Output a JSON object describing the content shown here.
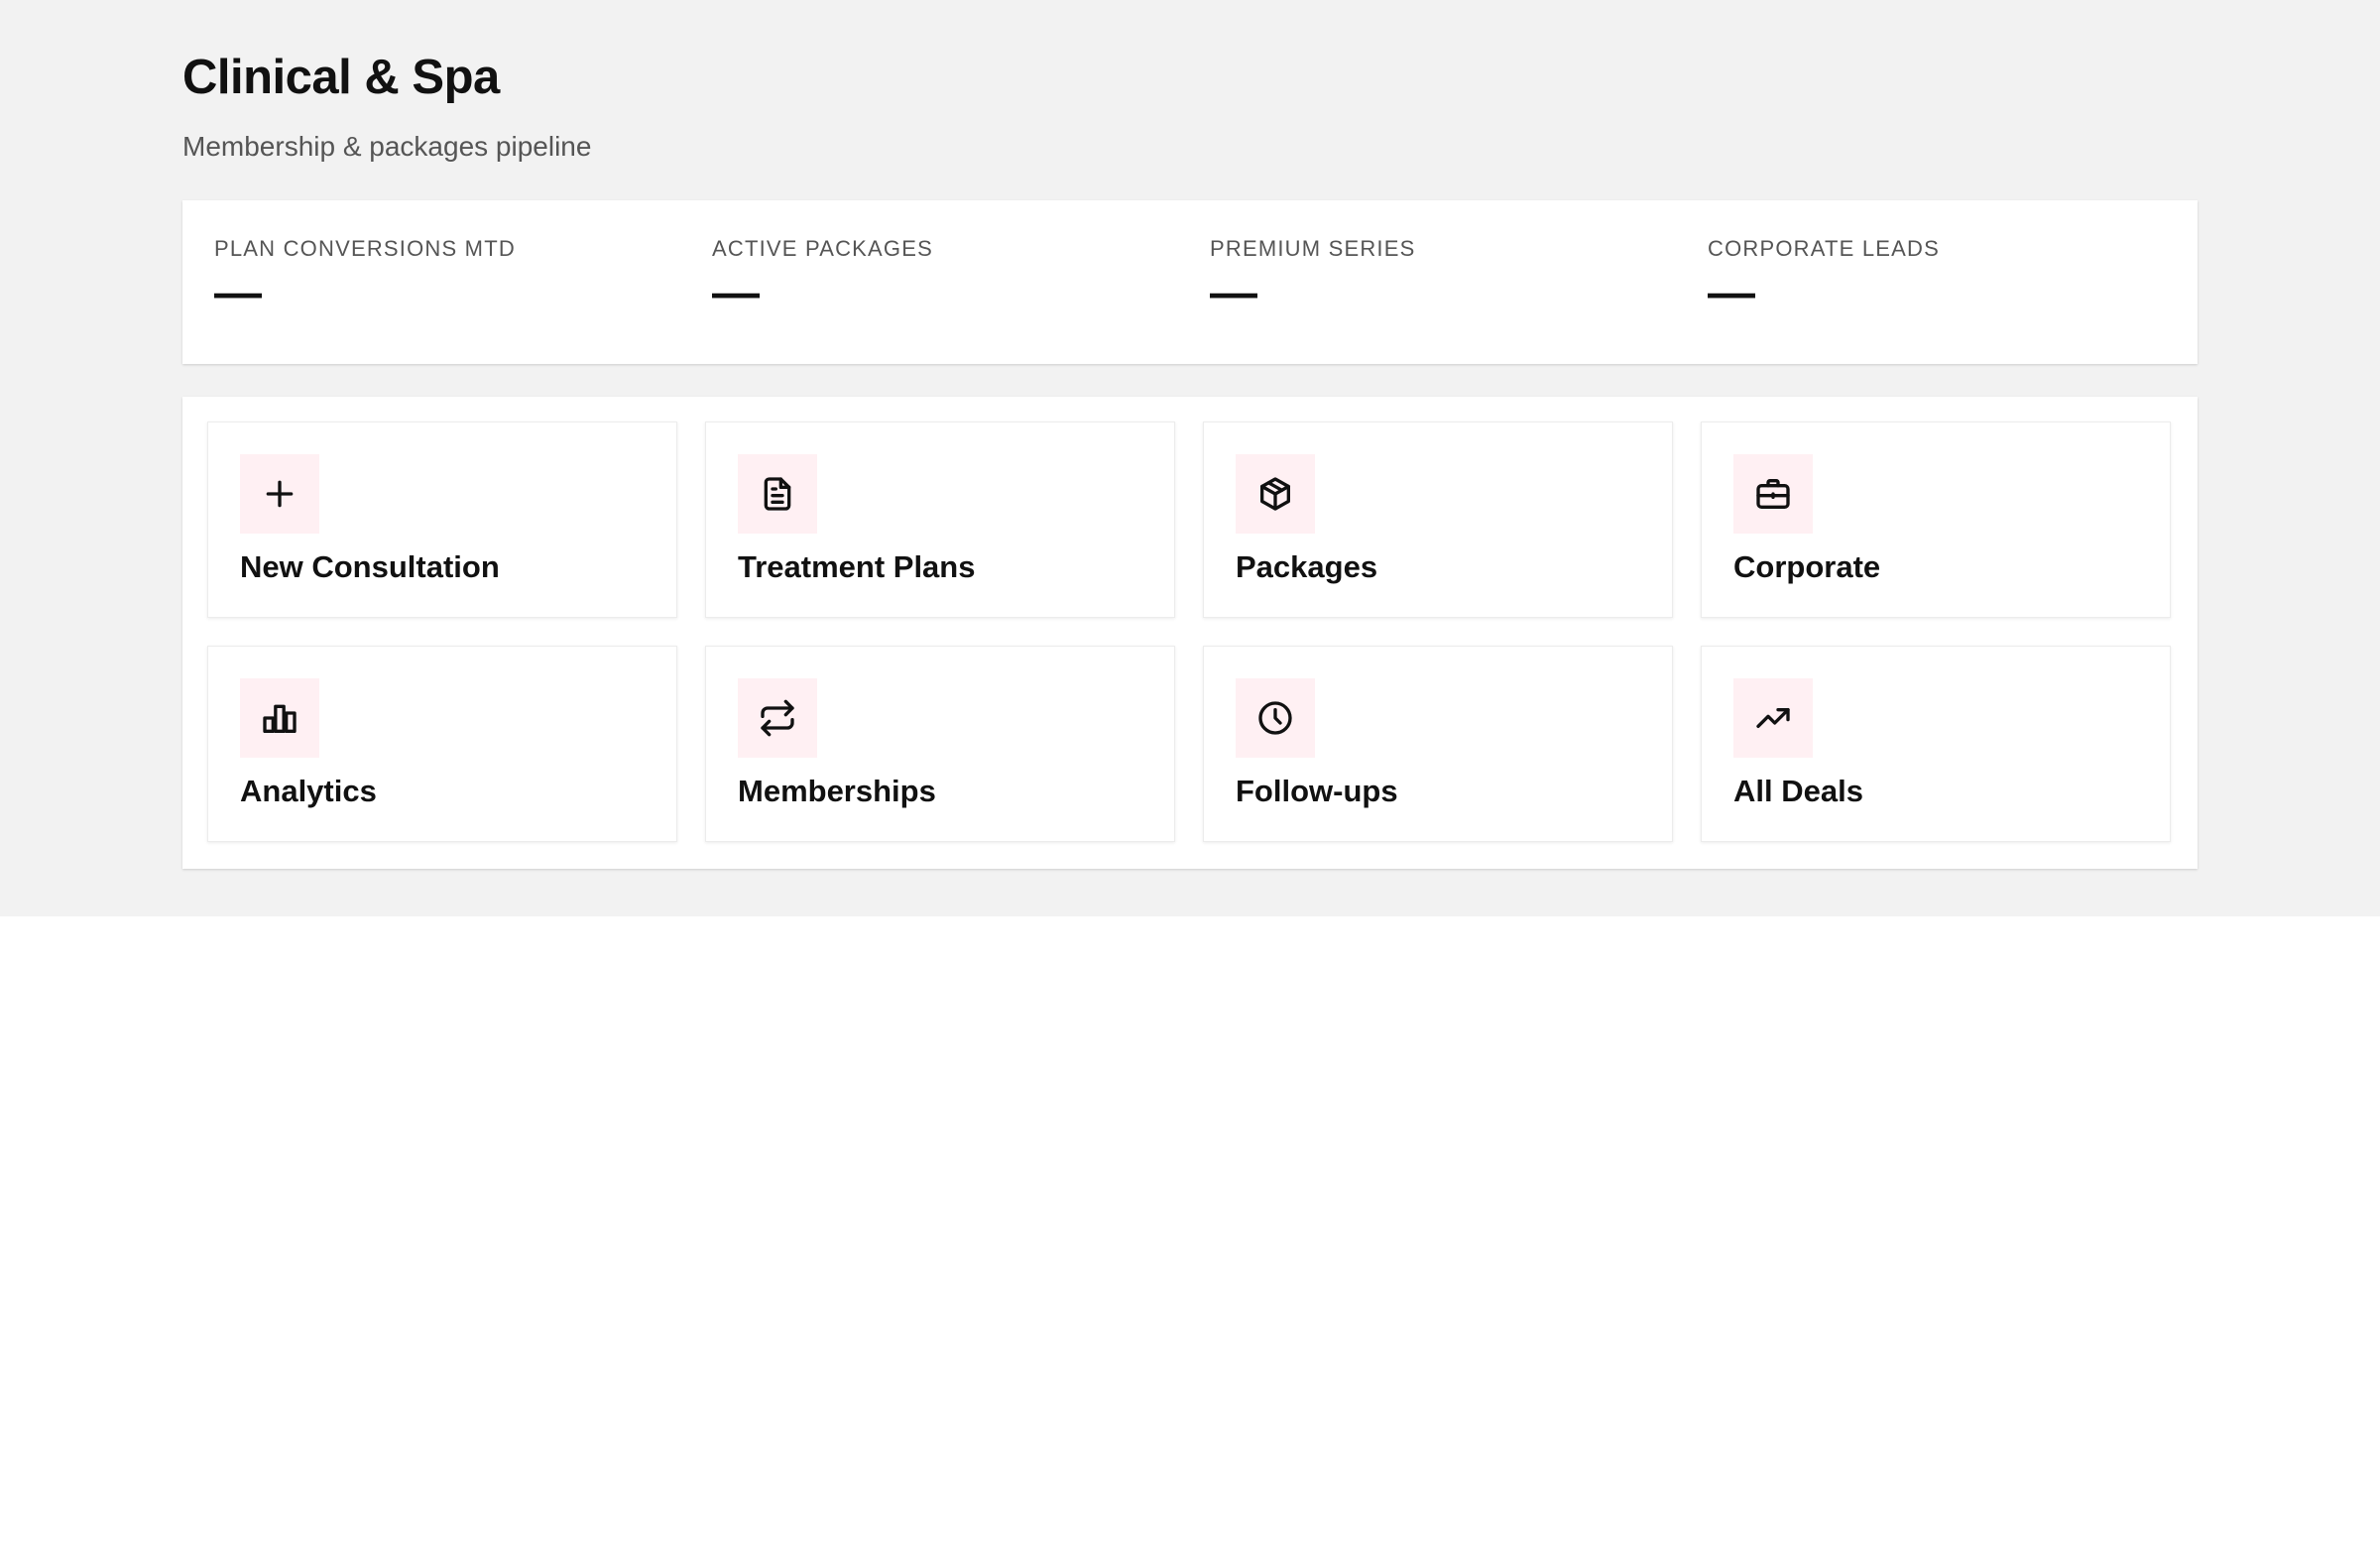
{
  "header": {
    "title": "Clinical & Spa",
    "subtitle": "Membership & packages pipeline"
  },
  "stats": [
    {
      "label": "PLAN CONVERSIONS MTD",
      "value": "—"
    },
    {
      "label": "ACTIVE PACKAGES",
      "value": "—"
    },
    {
      "label": "PREMIUM SERIES",
      "value": "—"
    },
    {
      "label": "CORPORATE LEADS",
      "value": "—"
    }
  ],
  "actions": [
    {
      "label": "New Consultation",
      "icon": "plus-icon"
    },
    {
      "label": "Treatment Plans",
      "icon": "document-icon"
    },
    {
      "label": "Packages",
      "icon": "package-icon"
    },
    {
      "label": "Corporate",
      "icon": "briefcase-icon"
    },
    {
      "label": "Analytics",
      "icon": "bar-chart-icon"
    },
    {
      "label": "Memberships",
      "icon": "repeat-icon"
    },
    {
      "label": "Follow-ups",
      "icon": "clock-icon"
    },
    {
      "label": "All Deals",
      "icon": "trending-up-icon"
    }
  ],
  "colors": {
    "page_background": "#f2f2f2",
    "icon_tile_background": "#fff0f3",
    "text_primary": "#111111",
    "text_secondary": "#555555"
  }
}
